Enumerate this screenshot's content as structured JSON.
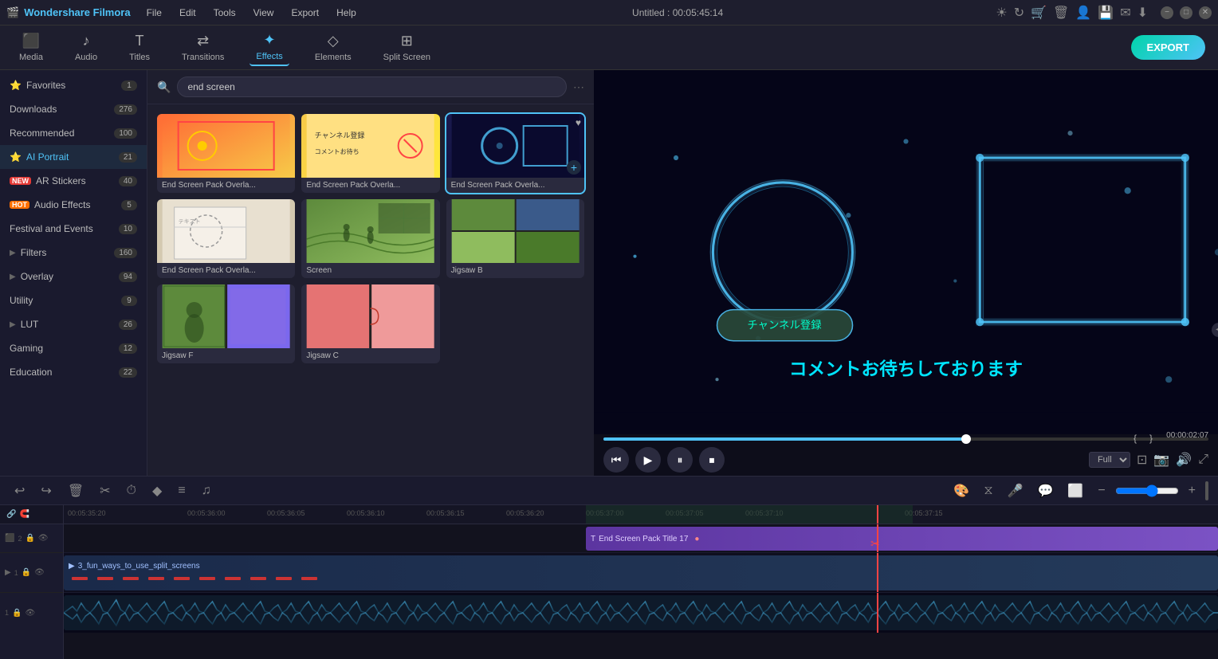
{
  "app": {
    "name": "Wondershare Filmora",
    "logo_icon": "🎬",
    "title": "Untitled : 00:05:45:14"
  },
  "menu": {
    "items": [
      "File",
      "Edit",
      "Tools",
      "View",
      "Export",
      "Help"
    ]
  },
  "toolbar": {
    "items": [
      {
        "id": "media",
        "label": "Media",
        "icon": "⬛"
      },
      {
        "id": "audio",
        "label": "Audio",
        "icon": "🎵"
      },
      {
        "id": "titles",
        "label": "Titles",
        "icon": "T"
      },
      {
        "id": "transitions",
        "label": "Transitions",
        "icon": "⇌"
      },
      {
        "id": "effects",
        "label": "Effects",
        "icon": "✦"
      },
      {
        "id": "elements",
        "label": "Elements",
        "icon": "◇"
      },
      {
        "id": "split_screen",
        "label": "Split Screen",
        "icon": "⊞"
      }
    ],
    "active": "effects",
    "export_label": "EXPORT"
  },
  "sidebar": {
    "items": [
      {
        "id": "favorites",
        "label": "Favorites",
        "count": "1",
        "icon": "⭐",
        "badge_type": "normal",
        "has_chevron": false
      },
      {
        "id": "downloads",
        "label": "Downloads",
        "count": "276",
        "icon": "",
        "badge_type": "normal",
        "has_chevron": false
      },
      {
        "id": "recommended",
        "label": "Recommended",
        "count": "100",
        "icon": "",
        "badge_type": "normal",
        "has_chevron": false
      },
      {
        "id": "ai_portrait",
        "label": "AI Portrait",
        "count": "21",
        "icon": "⭐",
        "badge_type": "normal",
        "has_chevron": false,
        "active": true
      },
      {
        "id": "ar_stickers",
        "label": "AR Stickers",
        "count": "40",
        "icon": "🆕",
        "badge_type": "new",
        "has_chevron": false
      },
      {
        "id": "audio_effects",
        "label": "Audio Effects",
        "count": "5",
        "icon": "🔥",
        "badge_type": "hot",
        "has_chevron": false
      },
      {
        "id": "festival_events",
        "label": "Festival and Events",
        "count": "10",
        "icon": "",
        "badge_type": "normal",
        "has_chevron": false
      },
      {
        "id": "filters",
        "label": "Filters",
        "count": "160",
        "icon": "",
        "badge_type": "normal",
        "has_chevron": true
      },
      {
        "id": "overlay",
        "label": "Overlay",
        "count": "94",
        "icon": "",
        "badge_type": "normal",
        "has_chevron": true
      },
      {
        "id": "utility",
        "label": "Utility",
        "count": "9",
        "icon": "",
        "badge_type": "normal",
        "has_chevron": false
      },
      {
        "id": "lut",
        "label": "LUT",
        "count": "26",
        "icon": "",
        "badge_type": "normal",
        "has_chevron": true
      },
      {
        "id": "gaming",
        "label": "Gaming",
        "count": "12",
        "icon": "",
        "badge_type": "normal",
        "has_chevron": false
      },
      {
        "id": "education",
        "label": "Education",
        "count": "22",
        "icon": "",
        "badge_type": "normal",
        "has_chevron": false
      }
    ]
  },
  "search": {
    "value": "end screen",
    "placeholder": "Search effects..."
  },
  "effects_grid": {
    "items": [
      {
        "id": 1,
        "label": "End Screen Pack Overla...",
        "thumb_type": "orange",
        "selected": false,
        "has_heart": false,
        "has_plus": false
      },
      {
        "id": 2,
        "label": "End Screen Pack Overla...",
        "thumb_type": "yellow",
        "selected": false,
        "has_heart": false,
        "has_plus": false
      },
      {
        "id": 3,
        "label": "End Screen Pack Overla...",
        "thumb_type": "blue",
        "selected": true,
        "has_heart": true,
        "has_plus": true
      },
      {
        "id": 4,
        "label": "End Screen Pack Overla...",
        "thumb_type": "paper",
        "selected": false,
        "has_heart": false,
        "has_plus": false
      },
      {
        "id": 5,
        "label": "Screen",
        "thumb_type": "vineyard",
        "selected": false,
        "has_heart": false,
        "has_plus": false
      },
      {
        "id": 6,
        "label": "Jigsaw B",
        "thumb_type": "puzzle_blue",
        "selected": false,
        "has_heart": false,
        "has_plus": false
      },
      {
        "id": 7,
        "label": "Jigsaw F",
        "thumb_type": "puzzle_purple",
        "selected": false,
        "has_heart": false,
        "has_plus": false
      },
      {
        "id": 8,
        "label": "Jigsaw C",
        "thumb_type": "puzzle_red",
        "selected": false,
        "has_heart": false,
        "has_plus": false
      }
    ]
  },
  "preview": {
    "time_current": "00:00:02:07",
    "time_total": "00:05:45:14",
    "quality": "Full",
    "progress_percent": 0.6
  },
  "playback": {
    "controls": [
      "⏮",
      "▶",
      "⏸",
      "⏹"
    ]
  },
  "timeline": {
    "buttons": [
      "↩",
      "↪",
      "🗑",
      "✂",
      "⏱",
      "◆",
      "≡",
      "♫"
    ],
    "timestamps": [
      "00:05:35:20",
      "00:05:36:00",
      "00:05:36:05",
      "00:05:36:10",
      "00:05:36:15",
      "00:05:36:20",
      "00:05:37:00",
      "00:05:37:05",
      "00:05:37:10",
      "00:05:37:15"
    ],
    "tracks": [
      {
        "id": "track1",
        "icons": [
          "🔗",
          "🔒",
          "👁"
        ],
        "type": "effects",
        "clip_label": "End Screen Pack Title 17"
      },
      {
        "id": "track2",
        "icons": [
          "▶",
          "🔒",
          "👁"
        ],
        "type": "video",
        "clip_label": "3_fun_ways_to_use_split_screens"
      },
      {
        "id": "track3",
        "icons": [],
        "type": "audio",
        "clip_label": ""
      }
    ],
    "playhead_position_percent": 85
  }
}
